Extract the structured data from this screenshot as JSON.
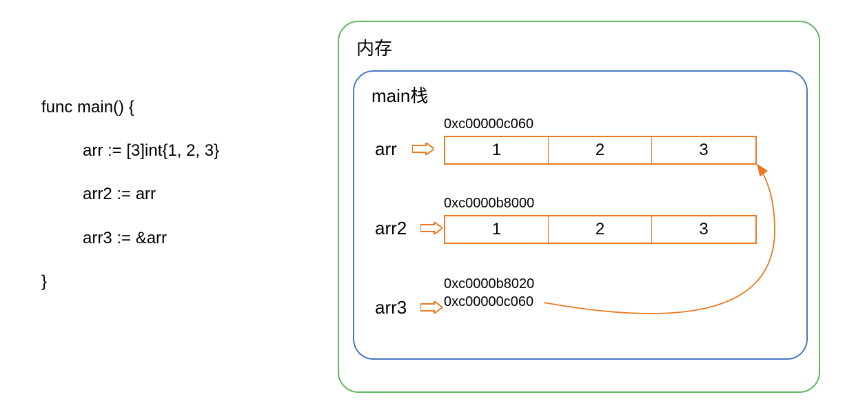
{
  "code": {
    "l1": "func main() {",
    "l2": "arr := [3]int{1, 2, 3}",
    "l3": "arr2 := arr",
    "l4": "arr3 := &arr",
    "l5": "}"
  },
  "memory": {
    "title": "内存",
    "stack_title": "main栈",
    "arr": {
      "name": "arr",
      "address": "0xc00000c060",
      "cells": [
        "1",
        "2",
        "3"
      ]
    },
    "arr2": {
      "name": "arr2",
      "address": "0xc0000b8000",
      "cells": [
        "1",
        "2",
        "3"
      ]
    },
    "arr3": {
      "name": "arr3",
      "address": "0xc0000b8020",
      "value": "0xc00000c060"
    }
  },
  "colors": {
    "outer_border": "#5fb85f",
    "inner_border": "#4a78c4",
    "accent": "#e8791e"
  }
}
